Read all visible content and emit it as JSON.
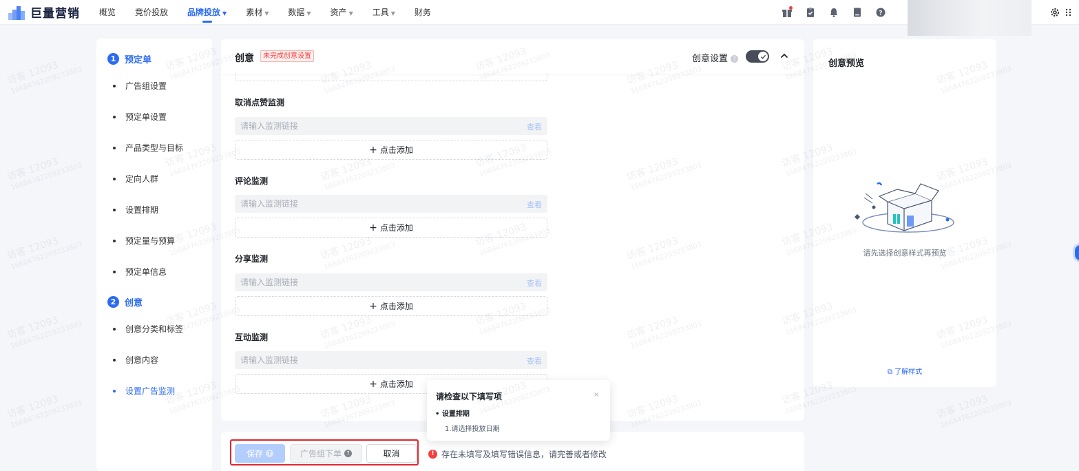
{
  "brand": {
    "name": "巨量营销"
  },
  "nav": [
    {
      "label": "概览",
      "caret": false
    },
    {
      "label": "竞价投放",
      "caret": false
    },
    {
      "label": "品牌投放",
      "caret": true,
      "active": true
    },
    {
      "label": "素材",
      "caret": true
    },
    {
      "label": "数据",
      "caret": true
    },
    {
      "label": "资产",
      "caret": true
    },
    {
      "label": "工具",
      "caret": true
    },
    {
      "label": "财务",
      "caret": false
    }
  ],
  "top_icons": [
    "gift-icon",
    "clipboard-check-icon",
    "bell-icon",
    "book-icon",
    "help-circle-icon"
  ],
  "steps": {
    "group1": {
      "num": "1",
      "title": "预定单",
      "items": [
        "广告组设置",
        "预定单设置",
        "产品类型与目标",
        "定向人群",
        "设置排期",
        "预定量与预算",
        "预定单信息"
      ]
    },
    "group2": {
      "num": "2",
      "title": "创意",
      "items": [
        "创意分类和标签",
        "创意内容",
        "设置广告监测"
      ],
      "active_index": 2
    }
  },
  "card": {
    "title": "创意",
    "warning_tag": "未完成创意设置",
    "setting_label": "创意设置",
    "toggle_on": true
  },
  "monitors": [
    {
      "label": "取消点赞监测",
      "placeholder": "请输入监测链接",
      "view": "查看",
      "add": "点击添加"
    },
    {
      "label": "评论监测",
      "placeholder": "请输入监测链接",
      "view": "查看",
      "add": "点击添加"
    },
    {
      "label": "分享监测",
      "placeholder": "请输入监测链接",
      "view": "查看",
      "add": "点击添加"
    },
    {
      "label": "互动监测",
      "placeholder": "请输入监测链接",
      "view": "查看",
      "add": "点击添加"
    }
  ],
  "preview": {
    "title": "创意预览",
    "empty_text": "请先选择创意样式再预览",
    "learn_link": "了解样式"
  },
  "popover": {
    "title": "请检查以下填写项",
    "item": "设置排期",
    "sub": "1.请选择投放日期",
    "close": "×"
  },
  "footer": {
    "save": "保存",
    "order": "广告组下单",
    "cancel": "取消",
    "error": "存在未填写及填写错误信息，请完善或者修改"
  },
  "watermark": {
    "line1": "访客 12093",
    "line2": "16684762209233803"
  },
  "colors": {
    "accent": "#2b6bf3",
    "danger": "#f53f3f",
    "toggle": "#474c58"
  }
}
